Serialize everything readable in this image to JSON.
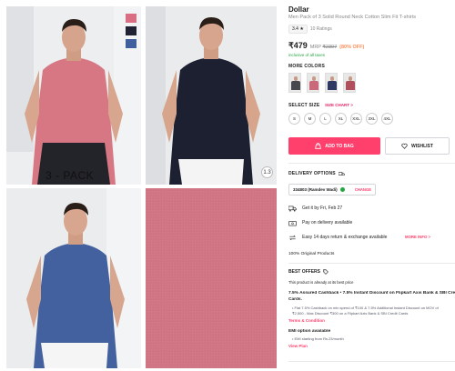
{
  "gallery": {
    "pack_label": "3 - PACK",
    "swatch_colors": [
      "#d96f83",
      "#1f2333",
      "#3f5f9f"
    ],
    "shirt_colors": {
      "pink": "#d77784",
      "navy": "#1d2030",
      "blue": "#44619f"
    }
  },
  "product": {
    "brand": "Dollar",
    "title": "Men Pack of 3 Solid Round Neck Cotton Slim Fit T-shirts",
    "rating": "3.4 ★",
    "rating_count": "10 Ratings",
    "price": "₹479",
    "mrp_label": "MRP",
    "mrp": "₹2397",
    "discount": "(80% OFF)",
    "tax_note": "inclusive of all taxes"
  },
  "colors": {
    "title": "MORE COLORS",
    "thumbs": [
      "#47484d",
      "#c9697a",
      "#2e3a63",
      "#b04f5e"
    ]
  },
  "sizes": {
    "title": "SELECT SIZE",
    "chart_link": "SIZE CHART >",
    "options": [
      "S",
      "M",
      "L",
      "XL",
      "XXL",
      "3XL",
      "4XL"
    ]
  },
  "actions": {
    "add_to_bag": "ADD TO BAG",
    "wishlist": "WISHLIST"
  },
  "delivery": {
    "title": "DELIVERY OPTIONS",
    "pincode": "334803 (Ramdev Wadi)",
    "change": "CHANGE",
    "get_it": "Get it by Fri, Feb 27",
    "cod": "Pay on delivery available",
    "returns": "Easy 14 days return & exchange available",
    "more_info": "MORE INFO >"
  },
  "original": "100% Original Products",
  "offers": {
    "title": "BEST OFFERS",
    "subtitle": "This product is already at its best price",
    "offer1_title": "7.5% Assured Cashback • 7.5% Instant Discount on Flipkart Axis Bank & SBI Credit",
    "offer1_title2": "Cards.",
    "offer1_b1": "Flat 7.5% Cashback on min spend of ₹100 & 7.5% Additional Instant Discount on MOV of",
    "offer1_b2": "₹2,500 - Max Discount ₹300 on a Flipkart Axis Bank & SBI Credit Cards",
    "terms": "Terms & Condition",
    "emi_title": "EMI option available",
    "emi_b1": "EMI starting from Rs.23/month",
    "view_plan": "View Plan"
  }
}
